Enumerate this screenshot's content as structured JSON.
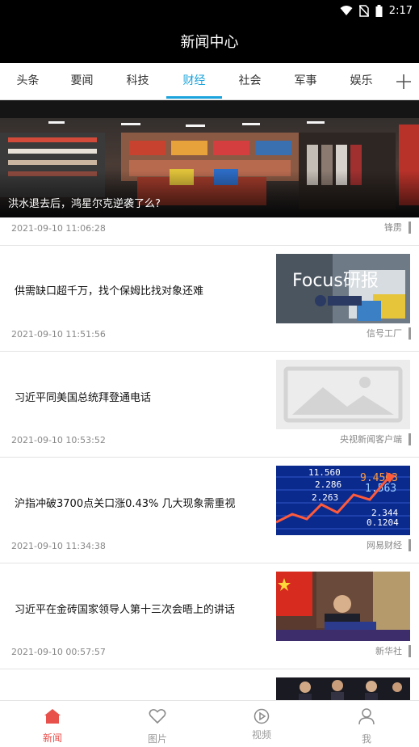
{
  "status": {
    "time": "2:17"
  },
  "header": {
    "title": "新闻中心"
  },
  "tabs": [
    {
      "label": "头条"
    },
    {
      "label": "要闻"
    },
    {
      "label": "科技"
    },
    {
      "label": "财经"
    },
    {
      "label": "社会"
    },
    {
      "label": "军事"
    },
    {
      "label": "娱乐"
    }
  ],
  "active_tab": "财经",
  "hero": {
    "caption": "洪水退去后，鸿星尔克逆袭了么?",
    "time": "2021-09-10 11:06:28",
    "source": "锋雳"
  },
  "news": [
    {
      "title": "供需缺口超千万，找个保姆比找对象还难",
      "time": "2021-09-10 11:51:56",
      "source": "信号工厂",
      "thumb_text": "Focus研报"
    },
    {
      "title": "习近平同美国总统拜登通电话",
      "time": "2021-09-10 10:53:52",
      "source": "央视新闻客户端"
    },
    {
      "title": "沪指冲破3700点关口涨0.43% 几大现象需重视",
      "time": "2021-09-10 11:34:38",
      "source": "网易财经"
    },
    {
      "title": "习近平在金砖国家领导人第十三次会晤上的讲话",
      "time": "2021-09-10 00:57:57",
      "source": "新华社"
    }
  ],
  "stock_numbers": [
    "11.560",
    "2.286",
    "1.563",
    "2.263",
    "2.344",
    "0.1204",
    "9.4563"
  ],
  "bottom_nav": [
    {
      "label": "新闻",
      "icon": "home-icon"
    },
    {
      "label": "图片",
      "icon": "heart-icon"
    },
    {
      "label": "视频",
      "icon": "play-icon"
    },
    {
      "label": "我",
      "icon": "person-icon"
    }
  ],
  "colors": {
    "accent": "#1aa3dc",
    "nav_active": "#e8504c",
    "topbar": "#000000"
  }
}
